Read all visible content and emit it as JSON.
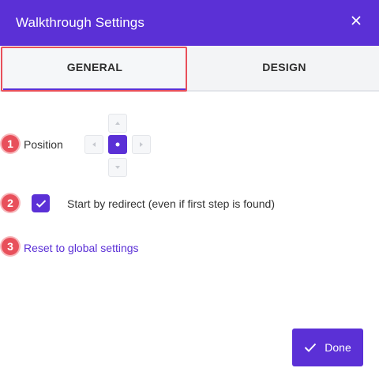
{
  "dialog": {
    "title": "Walkthrough Settings"
  },
  "tabs": [
    {
      "label": "GENERAL",
      "active": true
    },
    {
      "label": "DESIGN",
      "active": false
    }
  ],
  "annotations": [
    "1",
    "2",
    "3"
  ],
  "position": {
    "label": "Position",
    "selected": "center"
  },
  "redirect": {
    "label": "Start by redirect (even if first step is found)",
    "checked": true
  },
  "reset_link": "Reset to global settings",
  "done_button": {
    "label": "Done"
  },
  "colors": {
    "accent": "#5b30d6",
    "annotation": "#e8505b"
  },
  "icons": [
    "close-icon",
    "arrow-up-icon",
    "arrow-left-icon",
    "arrow-right-icon",
    "arrow-down-icon",
    "checkmark-icon"
  ]
}
